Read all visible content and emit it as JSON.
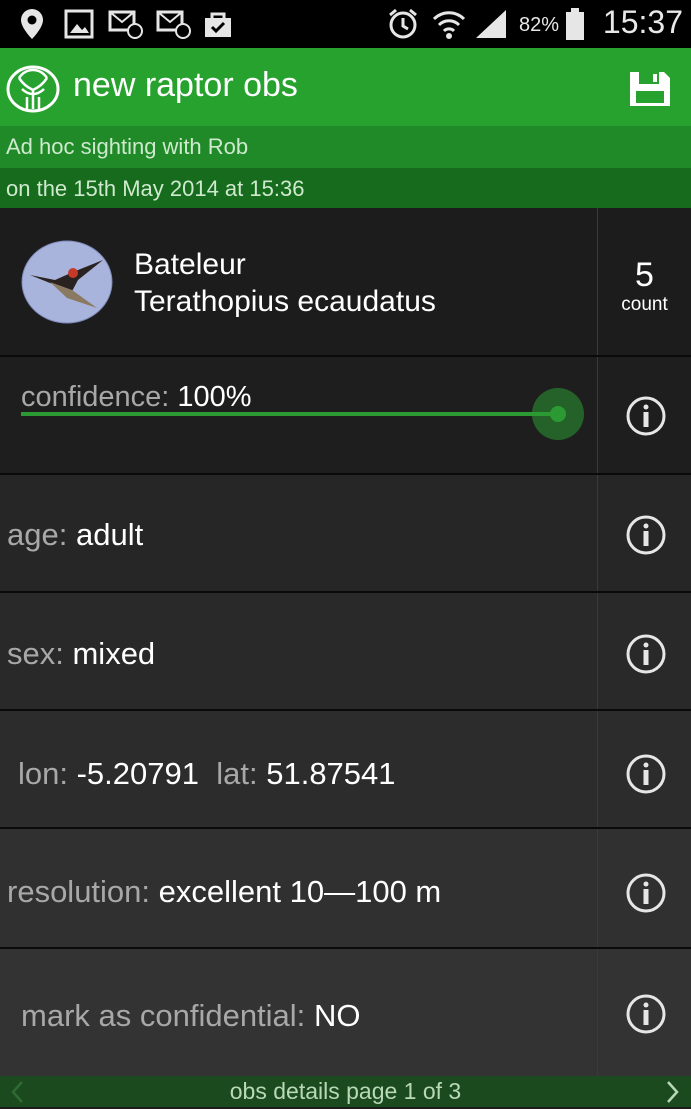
{
  "status_bar": {
    "battery": "82%",
    "time": "15:37",
    "icons": [
      "location-pin-icon",
      "gallery-icon",
      "email-icon",
      "email-icon",
      "shopping-bag-icon",
      "alarm-icon",
      "wifi-icon",
      "signal-icon",
      "battery-icon"
    ]
  },
  "app_bar": {
    "title": "new raptor obs",
    "icons": [
      "tree-logo-icon",
      "save-icon"
    ]
  },
  "subtitle": {
    "line1": "Ad hoc sighting with Rob",
    "line2": "on the 15th May 2014 at 15:36"
  },
  "species": {
    "common_name": "Bateleur",
    "scientific_name": "Terathopius ecaudatus",
    "count_value": "5",
    "count_label": "count"
  },
  "confidence": {
    "label": "confidence:",
    "value": "100%",
    "slider_level": 1.0
  },
  "age": {
    "label": "age:",
    "value": "adult"
  },
  "sex": {
    "label": "sex:",
    "value": "mixed"
  },
  "location": {
    "lon_label": "lon:",
    "lon_value": "-5.20791",
    "lat_label": "lat:",
    "lat_value": "51.87541"
  },
  "resolution": {
    "label": "resolution:",
    "value": "excellent 10—100 m"
  },
  "confidential": {
    "label": "mark as confidential:",
    "value": "NO"
  },
  "footer": {
    "text": "obs details page 1 of 3",
    "icons": [
      "chevron-left-icon",
      "chevron-right-icon"
    ]
  },
  "colors": {
    "accent_green": "#27a22f",
    "slider_green": "#2b9a33",
    "info_icon": "#e6e6e6"
  }
}
